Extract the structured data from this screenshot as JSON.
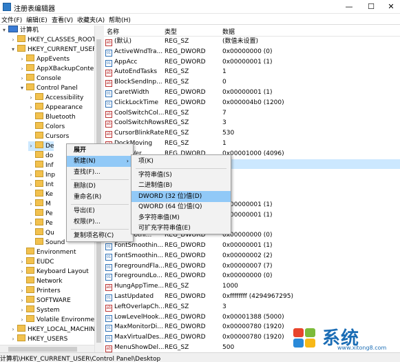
{
  "window": {
    "title": "注册表编辑器",
    "min": "—",
    "max": "☐",
    "close": "✕"
  },
  "menu": [
    "文件(F)",
    "编辑(E)",
    "查看(V)",
    "收藏夹(A)",
    "帮助(H)"
  ],
  "tree": [
    {
      "label": "计算机",
      "depth": 0,
      "exp": "▾",
      "icon": "pc"
    },
    {
      "label": "HKEY_CLASSES_ROOT",
      "depth": 1,
      "exp": "›",
      "icon": "folder"
    },
    {
      "label": "HKEY_CURRENT_USER",
      "depth": 1,
      "exp": "▾",
      "icon": "folder"
    },
    {
      "label": "AppEvents",
      "depth": 2,
      "exp": "›",
      "icon": "folder"
    },
    {
      "label": "AppXBackupConter",
      "depth": 2,
      "exp": "›",
      "icon": "folder"
    },
    {
      "label": "Console",
      "depth": 2,
      "exp": "›",
      "icon": "folder"
    },
    {
      "label": "Control Panel",
      "depth": 2,
      "exp": "▾",
      "icon": "folder"
    },
    {
      "label": "Accessibility",
      "depth": 3,
      "exp": "›",
      "icon": "folder"
    },
    {
      "label": "Appearance",
      "depth": 3,
      "exp": "›",
      "icon": "folder"
    },
    {
      "label": "Bluetooth",
      "depth": 3,
      "exp": "",
      "icon": "folder"
    },
    {
      "label": "Colors",
      "depth": 3,
      "exp": "",
      "icon": "folder"
    },
    {
      "label": "Cursors",
      "depth": 3,
      "exp": "",
      "icon": "folder"
    },
    {
      "label": "De",
      "depth": 3,
      "exp": "›",
      "icon": "folder",
      "selected": true
    },
    {
      "label": "do",
      "depth": 3,
      "exp": "",
      "icon": "folder"
    },
    {
      "label": "Inf",
      "depth": 3,
      "exp": "",
      "icon": "folder"
    },
    {
      "label": "Inp",
      "depth": 3,
      "exp": "›",
      "icon": "folder"
    },
    {
      "label": "Int",
      "depth": 3,
      "exp": "›",
      "icon": "folder"
    },
    {
      "label": "Ke",
      "depth": 3,
      "exp": "",
      "icon": "folder"
    },
    {
      "label": "M",
      "depth": 3,
      "exp": "›",
      "icon": "folder"
    },
    {
      "label": "Pe",
      "depth": 3,
      "exp": "",
      "icon": "folder"
    },
    {
      "label": "Pe",
      "depth": 3,
      "exp": "›",
      "icon": "folder"
    },
    {
      "label": "Qu",
      "depth": 3,
      "exp": "",
      "icon": "folder"
    },
    {
      "label": "Sound",
      "depth": 3,
      "exp": "",
      "icon": "folder"
    },
    {
      "label": "Environment",
      "depth": 2,
      "exp": "",
      "icon": "folder"
    },
    {
      "label": "EUDC",
      "depth": 2,
      "exp": "›",
      "icon": "folder"
    },
    {
      "label": "Keyboard Layout",
      "depth": 2,
      "exp": "›",
      "icon": "folder"
    },
    {
      "label": "Network",
      "depth": 2,
      "exp": "",
      "icon": "folder"
    },
    {
      "label": "Printers",
      "depth": 2,
      "exp": "›",
      "icon": "folder"
    },
    {
      "label": "SOFTWARE",
      "depth": 2,
      "exp": "›",
      "icon": "folder"
    },
    {
      "label": "System",
      "depth": 2,
      "exp": "›",
      "icon": "folder"
    },
    {
      "label": "Volatile Environmen",
      "depth": 2,
      "exp": "›",
      "icon": "folder"
    },
    {
      "label": "HKEY_LOCAL_MACHINE",
      "depth": 1,
      "exp": "›",
      "icon": "folder"
    },
    {
      "label": "HKEY_USERS",
      "depth": 1,
      "exp": "›",
      "icon": "folder"
    }
  ],
  "columns": {
    "name": "名称",
    "type": "类型",
    "data": "数据"
  },
  "rows": [
    {
      "name": "(默认)",
      "type": "REG_SZ",
      "data": "(数值未设置)",
      "icon": "str"
    },
    {
      "name": "ActiveWndTra...",
      "type": "REG_DWORD",
      "data": "0x00000000 (0)",
      "icon": "bin"
    },
    {
      "name": "AppAcc",
      "type": "REG_DWORD",
      "data": "0x00000001 (1)",
      "icon": "bin"
    },
    {
      "name": "AutoEndTasks",
      "type": "REG_SZ",
      "data": "1",
      "icon": "str"
    },
    {
      "name": "BlockSendInp...",
      "type": "REG_SZ",
      "data": "0",
      "icon": "str"
    },
    {
      "name": "CaretWidth",
      "type": "REG_DWORD",
      "data": "0x00000001 (1)",
      "icon": "bin"
    },
    {
      "name": "ClickLockTime",
      "type": "REG_DWORD",
      "data": "0x000004b0 (1200)",
      "icon": "bin"
    },
    {
      "name": "CoolSwitchCol...",
      "type": "REG_SZ",
      "data": "7",
      "icon": "str"
    },
    {
      "name": "CoolSwitchRows",
      "type": "REG_SZ",
      "data": "3",
      "icon": "str"
    },
    {
      "name": "CursorBlinkRate",
      "type": "REG_SZ",
      "data": "530",
      "icon": "str"
    },
    {
      "name": "DockMoving",
      "type": "REG_SZ",
      "data": "1",
      "icon": "str"
    },
    {
      "name": "...lingVer...",
      "type": "REG_DWORD",
      "data": "0x00001000 (4096)",
      "icon": "bin"
    },
    {
      "name": "",
      "type": "",
      "data": "",
      "icon": "",
      "hl": true
    },
    {
      "name": "",
      "type": "",
      "data": "",
      "icon": ""
    },
    {
      "name": "",
      "type": "",
      "data": "",
      "icon": ""
    },
    {
      "name": "",
      "type": "",
      "data": "",
      "icon": ""
    },
    {
      "name": "",
      "type": "REG_DWORD",
      "data": "0x00000001 (1)",
      "icon": ""
    },
    {
      "name": "",
      "type": "REG_DWORD",
      "data": "0x00000001 (1)",
      "icon": ""
    },
    {
      "name": "",
      "type": "",
      "data": "",
      "icon": ""
    },
    {
      "name": "...Smoothi...",
      "type": "REG_DWORD",
      "data": "0x00000000 (0)",
      "icon": "bin"
    },
    {
      "name": "FontSmoothin...",
      "type": "REG_DWORD",
      "data": "0x00000001 (1)",
      "icon": "bin"
    },
    {
      "name": "FontSmoothin...",
      "type": "REG_DWORD",
      "data": "0x00000002 (2)",
      "icon": "bin"
    },
    {
      "name": "ForegroundFla...",
      "type": "REG_DWORD",
      "data": "0x00000007 (7)",
      "icon": "bin"
    },
    {
      "name": "ForegroundLo...",
      "type": "REG_DWORD",
      "data": "0x00000000 (0)",
      "icon": "bin"
    },
    {
      "name": "HungAppTime...",
      "type": "REG_SZ",
      "data": "1000",
      "icon": "str"
    },
    {
      "name": "LastUpdated",
      "type": "REG_DWORD",
      "data": "0xffffffff (4294967295)",
      "icon": "bin"
    },
    {
      "name": "LeftOverlapCh...",
      "type": "REG_SZ",
      "data": "3",
      "icon": "str"
    },
    {
      "name": "LowLevelHook...",
      "type": "REG_DWORD",
      "data": "0x00001388 (5000)",
      "icon": "bin"
    },
    {
      "name": "MaxMonitorDi...",
      "type": "REG_DWORD",
      "data": "0x00000780 (1920)",
      "icon": "bin"
    },
    {
      "name": "MaxVirtualDes...",
      "type": "REG_DWORD",
      "data": "0x00000780 (1920)",
      "icon": "bin"
    },
    {
      "name": "MenuShowDel...",
      "type": "REG_SZ",
      "data": "500",
      "icon": "str"
    }
  ],
  "context_menu": [
    {
      "label": "展开",
      "bold": true
    },
    {
      "label": "新建(N)",
      "submenu": true,
      "hover": true
    },
    {
      "label": "查找(F)...",
      "sep_before": false
    },
    {
      "label": "删除(D)",
      "sep_before": true
    },
    {
      "label": "重命名(R)"
    },
    {
      "label": "导出(E)",
      "sep_before": true
    },
    {
      "label": "权限(P)..."
    },
    {
      "label": "复制项名称(C)",
      "sep_before": true
    }
  ],
  "submenu": [
    {
      "label": "项(K)"
    },
    {
      "label": "字符串值(S)",
      "sep_before": true
    },
    {
      "label": "二进制值(B)"
    },
    {
      "label": "DWORD (32 位)值(D)",
      "hover": true
    },
    {
      "label": "QWORD (64 位)值(Q)"
    },
    {
      "label": "多字符串值(M)"
    },
    {
      "label": "可扩充字符串值(E)"
    }
  ],
  "status": {
    "path": "计算机\\HKEY_CURRENT_USER\\Control Panel\\Desktop"
  },
  "logo": {
    "brand": "系统",
    "site": "www.xitong8.com"
  },
  "colors": {
    "selection": "#cce8ff",
    "menu_hover": "#91c9f7",
    "folder": "#f2c14e",
    "logo_blue": "#1b6db5"
  }
}
